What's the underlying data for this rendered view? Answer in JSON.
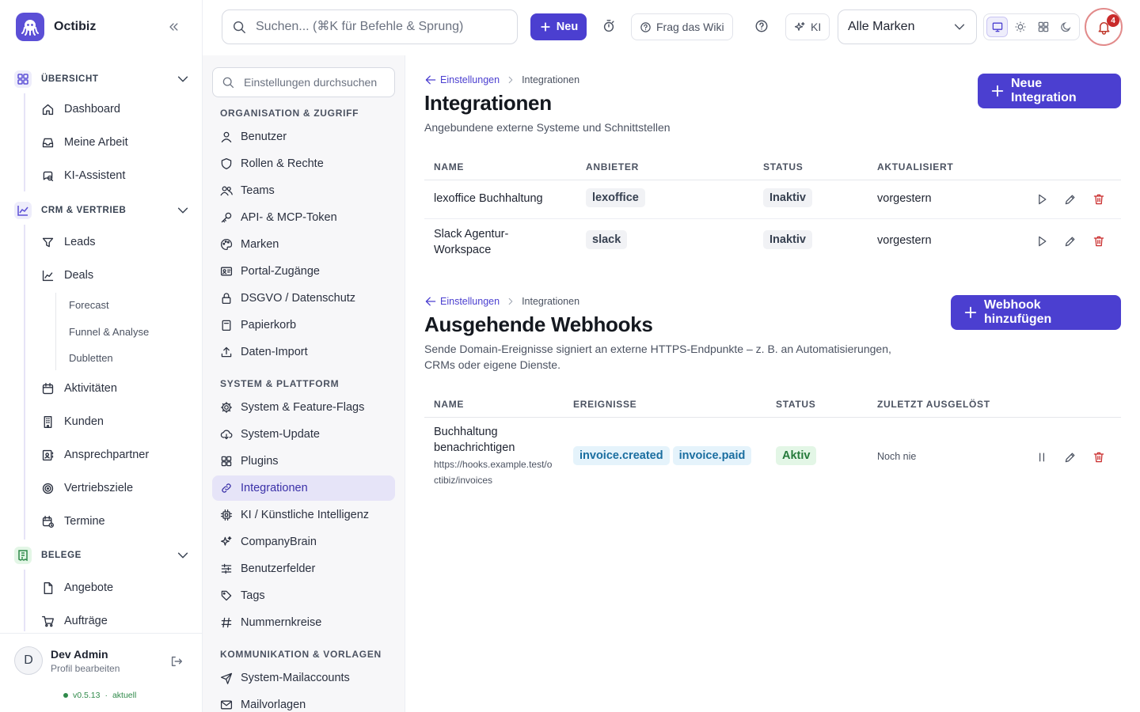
{
  "app": {
    "name": "Octibiz",
    "version": "v0.5.13",
    "version_status": "aktuell"
  },
  "topbar": {
    "search_placeholder": "Suchen... (⌘K für Befehle & Sprung)",
    "new_label": "Neu",
    "wiki_label": "Frag das Wiki",
    "ai_label": "KI",
    "brand_select": "Alle Marken",
    "notification_count": "4"
  },
  "sidebar": {
    "sections": [
      {
        "label": "ÜBERSICHT",
        "items": [
          "Dashboard",
          "Meine Arbeit",
          "KI-Assistent"
        ]
      },
      {
        "label": "CRM & VERTRIEB",
        "items": [
          "Leads",
          "Deals",
          "Aktivitäten",
          "Kunden",
          "Ansprechpartner",
          "Vertriebsziele",
          "Termine"
        ],
        "sub_items": [
          "Forecast",
          "Funnel & Analyse",
          "Dubletten"
        ]
      },
      {
        "label": "BELEGE",
        "items": [
          "Angebote",
          "Aufträge"
        ]
      }
    ],
    "user": {
      "initial": "D",
      "name": "Dev Admin",
      "sub": "Profil bearbeiten"
    }
  },
  "settings_nav": {
    "search_placeholder": "Einstellungen durchsuchen",
    "groups": [
      {
        "label": "ORGANISATION & ZUGRIFF",
        "items": [
          "Benutzer",
          "Rollen & Rechte",
          "Teams",
          "API- & MCP-Token",
          "Marken",
          "Portal-Zugänge",
          "DSGVO / Datenschutz",
          "Papierkorb",
          "Daten-Import"
        ]
      },
      {
        "label": "SYSTEM & PLATTFORM",
        "items": [
          "System & Feature-Flags",
          "System-Update",
          "Plugins",
          "Integrationen",
          "KI / Künstliche Intelligenz",
          "CompanyBrain",
          "Benutzerfelder",
          "Tags",
          "Nummernkreise"
        ]
      },
      {
        "label": "KOMMUNIKATION & VORLAGEN",
        "items": [
          "System-Mailaccounts",
          "Mailvorlagen"
        ]
      }
    ],
    "active": "Integrationen"
  },
  "integrations": {
    "breadcrumb_back": "Einstellungen",
    "breadcrumb_current": "Integrationen",
    "title": "Integrationen",
    "subtitle": "Angebundene externe Systeme und Schnittstellen",
    "new_button": "Neue Integration",
    "columns": [
      "NAME",
      "ANBIETER",
      "STATUS",
      "AKTUALISIERT"
    ],
    "rows": [
      {
        "name": "lexoffice Buchhaltung",
        "provider": "lexoffice",
        "status": "Inaktiv",
        "updated": "vorgestern"
      },
      {
        "name": "Slack Agentur-Workspace",
        "provider": "slack",
        "status": "Inaktiv",
        "updated": "vorgestern"
      }
    ]
  },
  "webhooks": {
    "breadcrumb_back": "Einstellungen",
    "breadcrumb_current": "Integrationen",
    "title": "Ausgehende Webhooks",
    "subtitle": "Sende Domain-Ereignisse signiert an externe HTTPS-Endpunkte – z. B. an Automatisierungen, CRMs oder eigene Dienste.",
    "add_button": "Webhook hinzufügen",
    "columns": [
      "NAME",
      "EREIGNISSE",
      "STATUS",
      "ZULETZT AUSGELÖST"
    ],
    "rows": [
      {
        "name": "Buchhaltung benachrichtigen",
        "url": "https://hooks.example.test/octibiz/invoices",
        "events": [
          "invoice.created",
          "invoice.paid"
        ],
        "status": "Aktiv",
        "last_triggered": "Noch nie"
      }
    ]
  },
  "colors": {
    "accent": "#4b3fd0",
    "danger": "#c92a2a",
    "success": "#257a3b"
  }
}
